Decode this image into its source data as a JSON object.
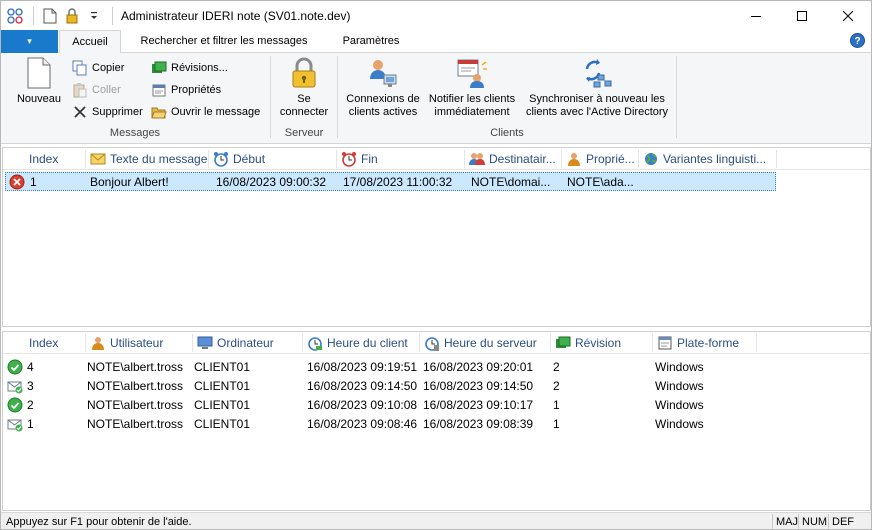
{
  "window": {
    "title": "Administrateur IDERI note (SV01.note.dev)",
    "minimize": "—",
    "maximize": "☐",
    "close": "✕"
  },
  "ribbon": {
    "app_menu_arrow": "▾",
    "tabs": [
      {
        "label": "Accueil",
        "active": true
      },
      {
        "label": "Rechercher et filtrer les messages",
        "active": false
      },
      {
        "label": "Paramètres",
        "active": false
      }
    ],
    "help": "?",
    "groups": {
      "messages": {
        "label": "Messages",
        "nouveau": "Nouveau",
        "copier": "Copier",
        "coller": "Coller",
        "supprimer": "Supprimer",
        "revisions": "Révisions...",
        "proprietes": "Propriétés",
        "ouvrir": "Ouvrir le message"
      },
      "serveur": {
        "label": "Serveur",
        "connecter_line1": "Se",
        "connecter_line2": "connecter"
      },
      "clients": {
        "label": "Clients",
        "connexions_line1": "Connexions de",
        "connexions_line2": "clients actives",
        "notifier_line1": "Notifier les clients",
        "notifier_line2": "immédiatement",
        "sync_line1": "Synchroniser à nouveau les",
        "sync_line2": "clients avec l'Active Directory"
      }
    }
  },
  "messages_list": {
    "columns": [
      "Index",
      "Texte du message",
      "Début",
      "Fin",
      "Destinatair...",
      "Proprié...",
      "Variantes linguisti..."
    ],
    "rows": [
      {
        "index": "1",
        "text": "Bonjour Albert!",
        "start": "16/08/2023 09:00:32",
        "end": "17/08/2023 11:00:32",
        "recipients": "NOTE\\domai...",
        "owner": "NOTE\\ada...",
        "variants": ""
      }
    ]
  },
  "receipts_list": {
    "columns": [
      "Index",
      "Utilisateur",
      "Ordinateur",
      "Heure du client",
      "Heure du serveur",
      "Révision",
      "Plate-forme"
    ],
    "rows": [
      {
        "status": "ok",
        "index": "4",
        "user": "NOTE\\albert.tross",
        "computer": "CLIENT01",
        "client_time": "16/08/2023 09:19:51",
        "server_time": "16/08/2023 09:20:01",
        "revision": "2",
        "platform": "Windows"
      },
      {
        "status": "received",
        "index": "3",
        "user": "NOTE\\albert.tross",
        "computer": "CLIENT01",
        "client_time": "16/08/2023 09:14:50",
        "server_time": "16/08/2023 09:14:50",
        "revision": "2",
        "platform": "Windows"
      },
      {
        "status": "ok",
        "index": "2",
        "user": "NOTE\\albert.tross",
        "computer": "CLIENT01",
        "client_time": "16/08/2023 09:10:08",
        "server_time": "16/08/2023 09:10:17",
        "revision": "1",
        "platform": "Windows"
      },
      {
        "status": "received",
        "index": "1",
        "user": "NOTE\\albert.tross",
        "computer": "CLIENT01",
        "client_time": "16/08/2023 09:08:46",
        "server_time": "16/08/2023 09:08:39",
        "revision": "1",
        "platform": "Windows"
      }
    ]
  },
  "statusbar": {
    "text": "Appuyez sur F1 pour obtenir de l'aide.",
    "indicators": [
      "MAJ",
      "NUM",
      "DEF"
    ]
  }
}
